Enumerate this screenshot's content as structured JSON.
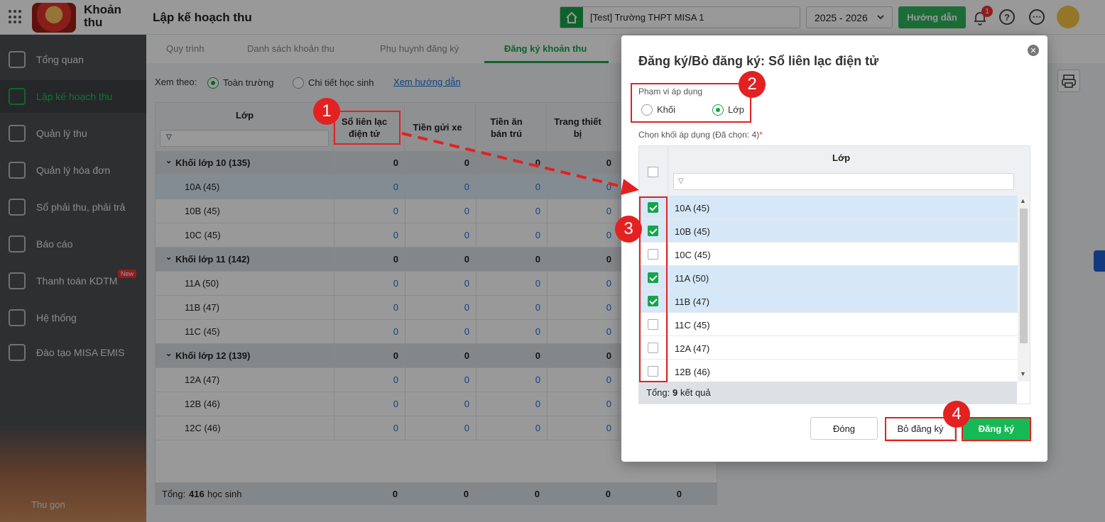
{
  "header": {
    "brand": "Khoản thu",
    "page_title": "Lập kế hoạch thu",
    "school": "[Test] Trường THPT MISA 1",
    "year": "2025 - 2026",
    "guide_button": "Hướng dẫn",
    "notif_count": "1"
  },
  "sidebar": {
    "items": [
      {
        "label": "Tổng quan",
        "icon": "chart-icon"
      },
      {
        "label": "Lập kế hoạch thu",
        "icon": "calendar-icon",
        "active": true
      },
      {
        "label": "Quản lý thu",
        "icon": "money-icon"
      },
      {
        "label": "Quản lý hóa đơn",
        "icon": "invoice-icon"
      },
      {
        "label": "Sổ phải thu, phải trả",
        "icon": "book-icon"
      },
      {
        "label": "Báo cáo",
        "icon": "pie-icon"
      },
      {
        "label": "Thanh toán KDTM",
        "icon": "card-icon"
      },
      {
        "label": "Hệ thống",
        "icon": "gear-icon"
      },
      {
        "label": "Đào tạo MISA EMIS",
        "icon": "open-book-icon"
      }
    ],
    "new_badge": "New",
    "collapse": "Thu gọn"
  },
  "tabs": [
    "Quy trình",
    "Danh sách khoản thu",
    "Phụ huynh đăng ký",
    "Đăng ký khoản thu"
  ],
  "viewby": {
    "label": "Xem theo:",
    "option1": "Toàn trường",
    "option2": "Chi tiết học sinh",
    "link": "Xem hướng dẫn"
  },
  "table": {
    "col_class": "Lớp",
    "columns": [
      "Sổ liên lạc điện tử",
      "Tiền gửi xe",
      "Tiền ăn bán trú",
      "Trang thiết bị"
    ],
    "rows": [
      {
        "name": "Khối lớp 10 (135)",
        "group": true,
        "values": [
          "0",
          "0",
          "0",
          "0"
        ]
      },
      {
        "name": "10A (45)",
        "sel": true,
        "values": [
          "0",
          "0",
          "0",
          "0"
        ]
      },
      {
        "name": "10B (45)",
        "values": [
          "0",
          "0",
          "0",
          "0"
        ]
      },
      {
        "name": "10C (45)",
        "values": [
          "0",
          "0",
          "0",
          "0"
        ]
      },
      {
        "name": "Khối lớp 11 (142)",
        "group": true,
        "values": [
          "0",
          "0",
          "0",
          "0"
        ]
      },
      {
        "name": "11A (50)",
        "values": [
          "0",
          "0",
          "0",
          "0"
        ]
      },
      {
        "name": "11B (47)",
        "values": [
          "0",
          "0",
          "0",
          "0"
        ]
      },
      {
        "name": "11C (45)",
        "values": [
          "0",
          "0",
          "0",
          "0"
        ]
      },
      {
        "name": "Khối lớp 12 (139)",
        "group": true,
        "values": [
          "0",
          "0",
          "0",
          "0"
        ]
      },
      {
        "name": "12A (47)",
        "values": [
          "0",
          "0",
          "0",
          "0"
        ]
      },
      {
        "name": "12B (46)",
        "values": [
          "0",
          "0",
          "0",
          "0"
        ]
      },
      {
        "name": "12C (46)",
        "values": [
          "0",
          "0",
          "0",
          "0"
        ]
      }
    ],
    "footer_label": "Tổng:",
    "footer_count": "416",
    "footer_suffix": "học sinh",
    "footer_values": [
      "0",
      "0",
      "0",
      "0",
      "0"
    ]
  },
  "dialog": {
    "title": "Đăng ký/Bỏ đăng ký: Sổ liên lạc điện tử",
    "scope_label": "Phạm vi áp dụng",
    "scope_opt1": "Khối",
    "scope_opt2": "Lớp",
    "select_label": "Chọn khối áp dụng (Đã chọn: 4)",
    "req": "*",
    "col_header": "Lớp",
    "rows": [
      {
        "name": "10A (45)",
        "checked": true
      },
      {
        "name": "10B (45)",
        "checked": true
      },
      {
        "name": "10C (45)",
        "checked": false
      },
      {
        "name": "11A (50)",
        "checked": true
      },
      {
        "name": "11B (47)",
        "checked": true
      },
      {
        "name": "11C (45)",
        "checked": false
      },
      {
        "name": "12A (47)",
        "checked": false
      },
      {
        "name": "12B (46)",
        "checked": false
      }
    ],
    "total_label": "Tổng:",
    "total_count": "9",
    "total_suffix": "kết quả",
    "btn_close": "Đóng",
    "btn_unregister": "Bỏ đăng ký",
    "btn_register": "Đăng ký"
  },
  "markers": [
    "1",
    "2",
    "3",
    "4"
  ],
  "colors": {
    "accent": "#17a34a",
    "annotation": "#e32121",
    "link": "#1a6fd8"
  }
}
